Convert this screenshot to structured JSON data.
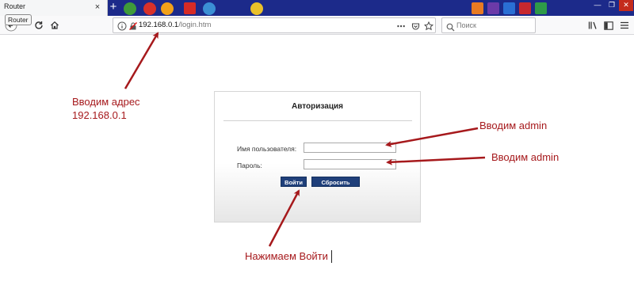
{
  "browser": {
    "tab": {
      "title": "Router",
      "tooltip": "Router",
      "close_glyph": "×"
    },
    "new_tab_glyph": "+",
    "window_controls": {
      "minimize": "—",
      "maximize": "❐",
      "close": "✕"
    },
    "url": {
      "host": "192.168.0.1",
      "path": "/login.htm"
    },
    "search": {
      "placeholder": "Поиск"
    },
    "icons": [
      "back-icon",
      "reload-icon",
      "home-icon",
      "info-icon",
      "insecure-lock-icon",
      "page-actions-icon",
      "pocket-icon",
      "bookmark-star-icon",
      "search-icon",
      "library-icon",
      "sidebar-icon",
      "menu-icon"
    ]
  },
  "login": {
    "title": "Авторизация",
    "username_label": "Имя пользователя:",
    "username_value": "",
    "password_label": "Пароль:",
    "password_value": "",
    "login_button": "Войти",
    "reset_button": "Сбросить"
  },
  "annotations": {
    "address_line1": "Вводим адрес",
    "address_line2": "192.168.0.1",
    "username_hint": "Вводим admin",
    "password_hint": "Вводим admin",
    "button_hint": "Нажимаем Войти"
  },
  "colors": {
    "annotation": "#a6191c",
    "button": "#1f3f7a",
    "tabstrip": "#1c2a8a"
  }
}
